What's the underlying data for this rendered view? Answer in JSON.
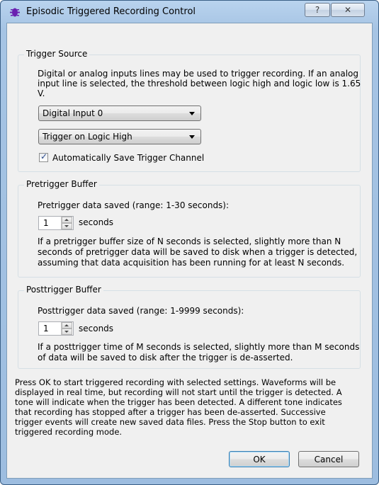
{
  "window": {
    "title": "Episodic Triggered Recording Control",
    "help_label": "?",
    "close_label": "✕"
  },
  "trigger_source": {
    "legend": "Trigger Source",
    "description_line1": "Digital or analog inputs lines may be used to trigger recording.  If an analog",
    "description_line2": "input line is selected, the threshold between logic high and logic low is 1.65",
    "description_line3": "V.",
    "input_select": "Digital Input 0",
    "logic_select": "Trigger on Logic High",
    "auto_save_label": "Automatically Save Trigger Channel",
    "auto_save_checked": true
  },
  "pretrigger": {
    "legend": "Pretrigger Buffer",
    "prompt": "Pretrigger data saved (range: 1-30 seconds):",
    "value": "1",
    "unit": "seconds",
    "note_line1": "If a pretrigger buffer size of N seconds is selected, slightly more than N",
    "note_line2": "seconds of pretrigger data will be saved to disk when a trigger is detected,",
    "note_line3": "assuming that data acquisition has been running for at least N seconds."
  },
  "posttrigger": {
    "legend": "Posttrigger Buffer",
    "prompt": "Posttrigger data saved (range: 1-9999 seconds):",
    "value": "1",
    "unit": "seconds",
    "note_line1": "If a posttrigger time of M seconds is selected, slightly more than M seconds",
    "note_line2": "of data will be saved to disk after the trigger is de-asserted."
  },
  "instructions": {
    "line1": "Press OK to start triggered recording with selected settings.  Waveforms will be",
    "line2": "displayed in real time, but recording will not start until the trigger is detected.  A",
    "line3": "tone will indicate when the trigger has been detected.  A different tone indicates",
    "line4": "that recording has stopped after a trigger has been de-asserted.  Successive",
    "line5": "trigger events will create new saved data files.  Press the Stop button to exit",
    "line6": "triggered recording mode."
  },
  "buttons": {
    "ok": "OK",
    "cancel": "Cancel"
  },
  "colors": {
    "accent": "#3c7fb1",
    "icon": "#6a1fb0"
  }
}
